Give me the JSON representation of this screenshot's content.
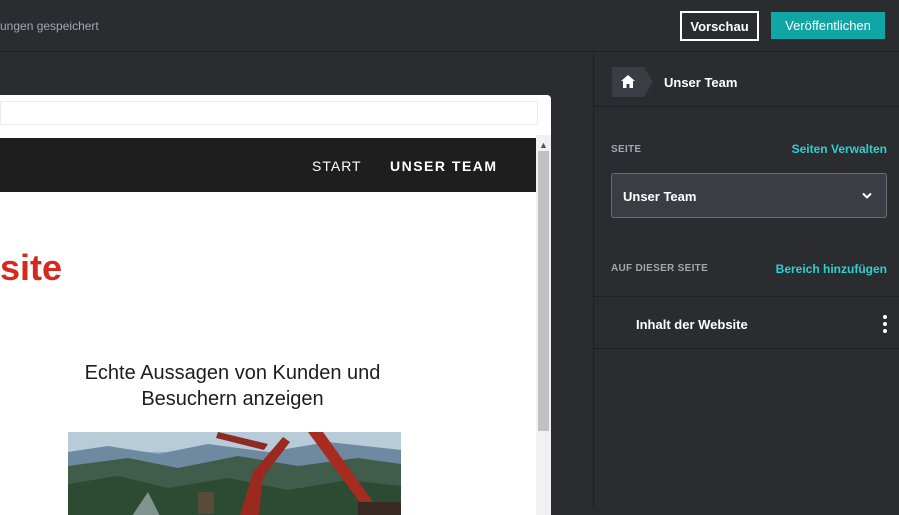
{
  "topbar": {
    "save_status": "ungen gespeichert",
    "preview_label": "Vorschau",
    "publish_label": "Veröffentlichen"
  },
  "site": {
    "nav": [
      {
        "label": "START"
      },
      {
        "label": "UNSER TEAM"
      }
    ],
    "title_fragment": "site",
    "tagline": "Echte Aussagen von Kunden und Besuchern anzeigen",
    "title_color": "#d4291f"
  },
  "panel": {
    "breadcrumb": {
      "home_icon": "home-icon",
      "current": "Unser Team"
    },
    "page_section": {
      "label": "SEITE",
      "link": "Seiten Verwalten"
    },
    "page_select": {
      "value": "Unser Team"
    },
    "on_page_section": {
      "label": "AUF DIESER SEITE",
      "link": "Bereich hinzufügen"
    },
    "sections": [
      {
        "label": "Inhalt der Website"
      }
    ],
    "accent_color": "#2ecfd0"
  }
}
